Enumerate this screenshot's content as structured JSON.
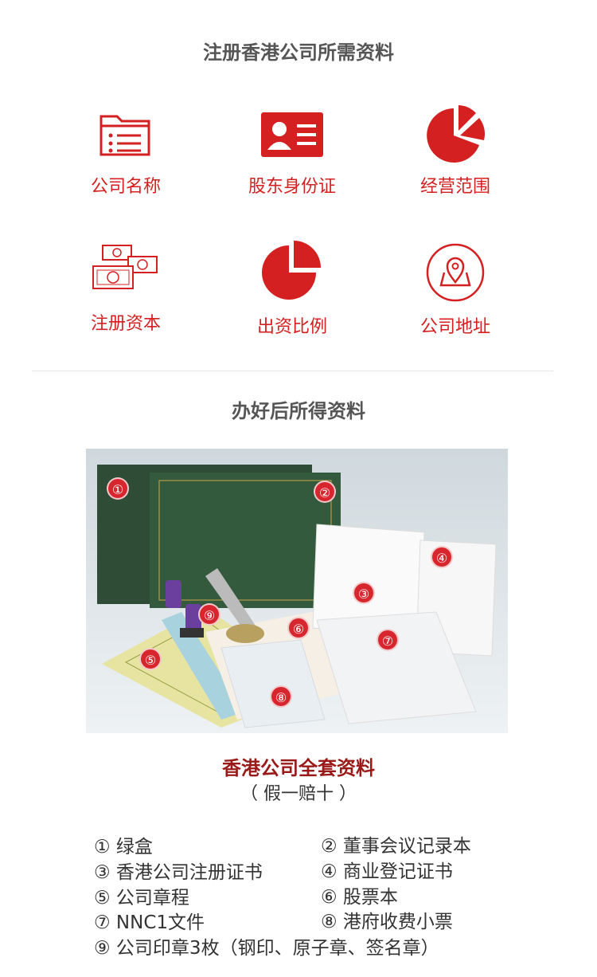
{
  "section1": {
    "title": "注册香港公司所需资料",
    "items": [
      {
        "label": "公司名称",
        "icon": "folder-list-icon"
      },
      {
        "label": "股东身份证",
        "icon": "id-card-icon"
      },
      {
        "label": "经营范围",
        "icon": "pie-chart-icon"
      },
      {
        "label": "注册资本",
        "icon": "banknotes-icon"
      },
      {
        "label": "出资比例",
        "icon": "pie-quarter-icon"
      },
      {
        "label": "公司地址",
        "icon": "map-pin-icon"
      }
    ]
  },
  "section2": {
    "title": "办好后所得资料",
    "photo_badges": [
      "①",
      "②",
      "③",
      "④",
      "⑤",
      "⑥",
      "⑦",
      "⑧",
      "⑨"
    ],
    "caption": "香港公司全套资料",
    "subcaption": "（ 假一赔十 ）",
    "list": [
      "① 绿盒",
      "② 董事会议记录本",
      "③ 香港公司注册证书",
      "④ 商业登记证书",
      "⑤ 公司章程",
      "⑥ 股票本",
      "⑦ NNC1文件",
      "⑧ 港府收费小票",
      "⑨ 公司印章3枚（钢印、原子章、签名章）"
    ]
  },
  "colors": {
    "accent": "#d42020",
    "title": "#555555",
    "caption": "#9a1a1a"
  }
}
